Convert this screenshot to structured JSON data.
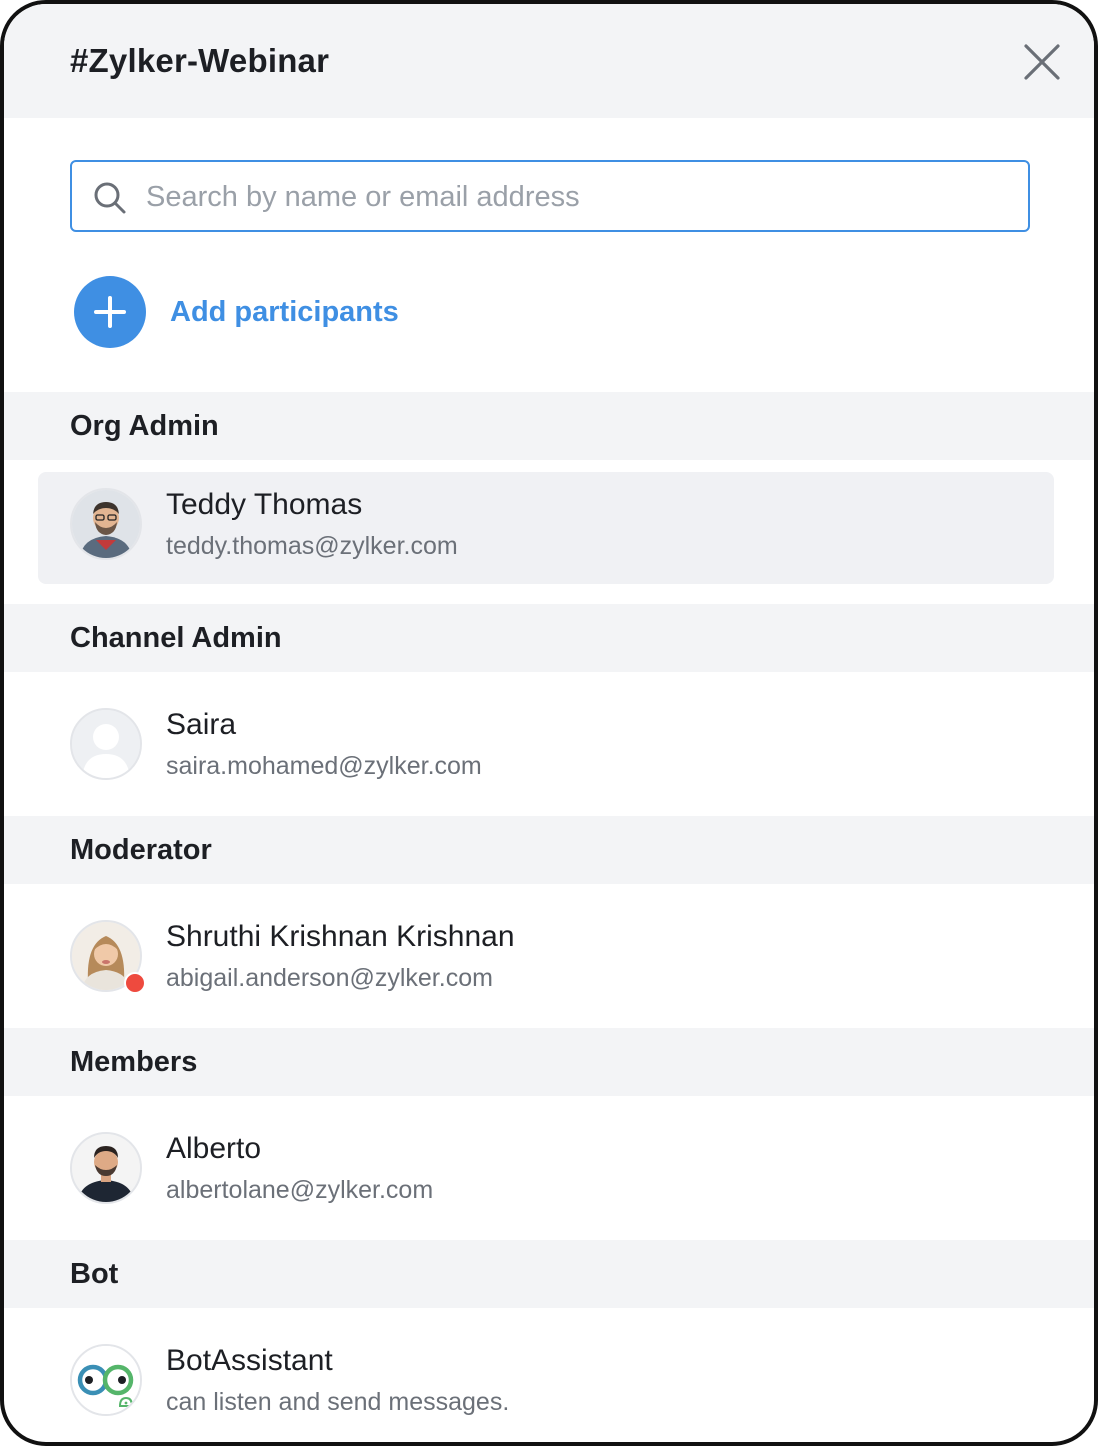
{
  "dialog": {
    "title": "#Zylker-Webinar",
    "close_icon": "close-icon"
  },
  "search": {
    "placeholder": "Search by name or email address",
    "value": "",
    "icon": "search-icon"
  },
  "add_participants": {
    "label": "Add participants",
    "icon": "plus-icon"
  },
  "sections": [
    {
      "label": "Org Admin",
      "members": [
        {
          "name": "Teddy Thomas",
          "subtitle": "teddy.thomas@zylker.com",
          "avatar": "photo-avatar",
          "highlighted": true
        }
      ]
    },
    {
      "label": "Channel Admin",
      "members": [
        {
          "name": "Saira",
          "subtitle": "saira.mohamed@zylker.com",
          "avatar": "placeholder-avatar"
        }
      ]
    },
    {
      "label": "Moderator",
      "members": [
        {
          "name": "Shruthi Krishnan Krishnan",
          "subtitle": "abigail.anderson@zylker.com",
          "avatar": "photo-avatar",
          "status": "busy"
        }
      ]
    },
    {
      "label": "Members",
      "members": [
        {
          "name": "Alberto",
          "subtitle": "albertolane@zylker.com",
          "avatar": "photo-avatar"
        }
      ]
    },
    {
      "label": "Bot",
      "members": [
        {
          "name": "BotAssistant",
          "subtitle": "can listen and send messages.",
          "avatar": "bot-avatar"
        }
      ]
    }
  ],
  "colors": {
    "accent": "#3f8fe3",
    "section_bg": "#f3f4f6",
    "status_busy": "#ee4a3e"
  }
}
